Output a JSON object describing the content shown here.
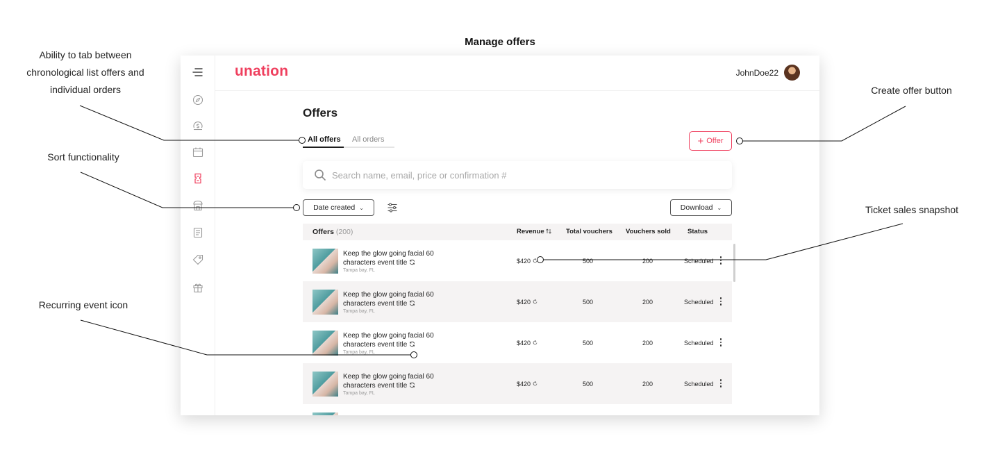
{
  "page_heading": "Manage offers",
  "annotations": {
    "tabs": "Ability to tab between chronological list offers and individual orders",
    "sort": "Sort functionality",
    "recurring": "Recurring event icon",
    "create": "Create offer button",
    "snapshot": "Ticket sales snapshot"
  },
  "brand": {
    "logo": "unation",
    "accent": "#ef3f5e"
  },
  "user": {
    "name": "JohnDoe22"
  },
  "sidebar": [
    "menu-icon",
    "compass-icon",
    "dollar-circle-icon",
    "calendar-icon",
    "ticket-icon",
    "store-icon",
    "receipt-icon",
    "tag-icon",
    "gift-icon"
  ],
  "main": {
    "title": "Offers",
    "tabs": [
      {
        "label": "All offers",
        "active": true
      },
      {
        "label": "All orders",
        "active": false
      }
    ],
    "add_button": "Offer",
    "search_placeholder": "Search name, email, price or confirmation #",
    "sort_label": "Date created",
    "download_label": "Download"
  },
  "table": {
    "headers": {
      "offers": "Offers",
      "count": "(200)",
      "revenue": "Revenue",
      "total": "Total vouchers",
      "sold": "Vouchers sold",
      "status": "Status"
    },
    "rows": [
      {
        "title": "Keep the glow going facial 60 characters event title",
        "location": "Tampa bay, FL",
        "revenue": "$420",
        "total": "500",
        "sold": "200",
        "status": "Scheduled"
      },
      {
        "title": "Keep the glow going facial 60 characters event title",
        "location": "Tampa bay, FL",
        "revenue": "$420",
        "total": "500",
        "sold": "200",
        "status": "Scheduled"
      },
      {
        "title": "Keep the glow going facial 60 characters event title",
        "location": "Tampa bay, FL",
        "revenue": "$420",
        "total": "500",
        "sold": "200",
        "status": "Scheduled"
      },
      {
        "title": "Keep the glow going facial 60 characters event title",
        "location": "Tampa bay, FL",
        "revenue": "$420",
        "total": "500",
        "sold": "200",
        "status": "Scheduled"
      }
    ]
  }
}
